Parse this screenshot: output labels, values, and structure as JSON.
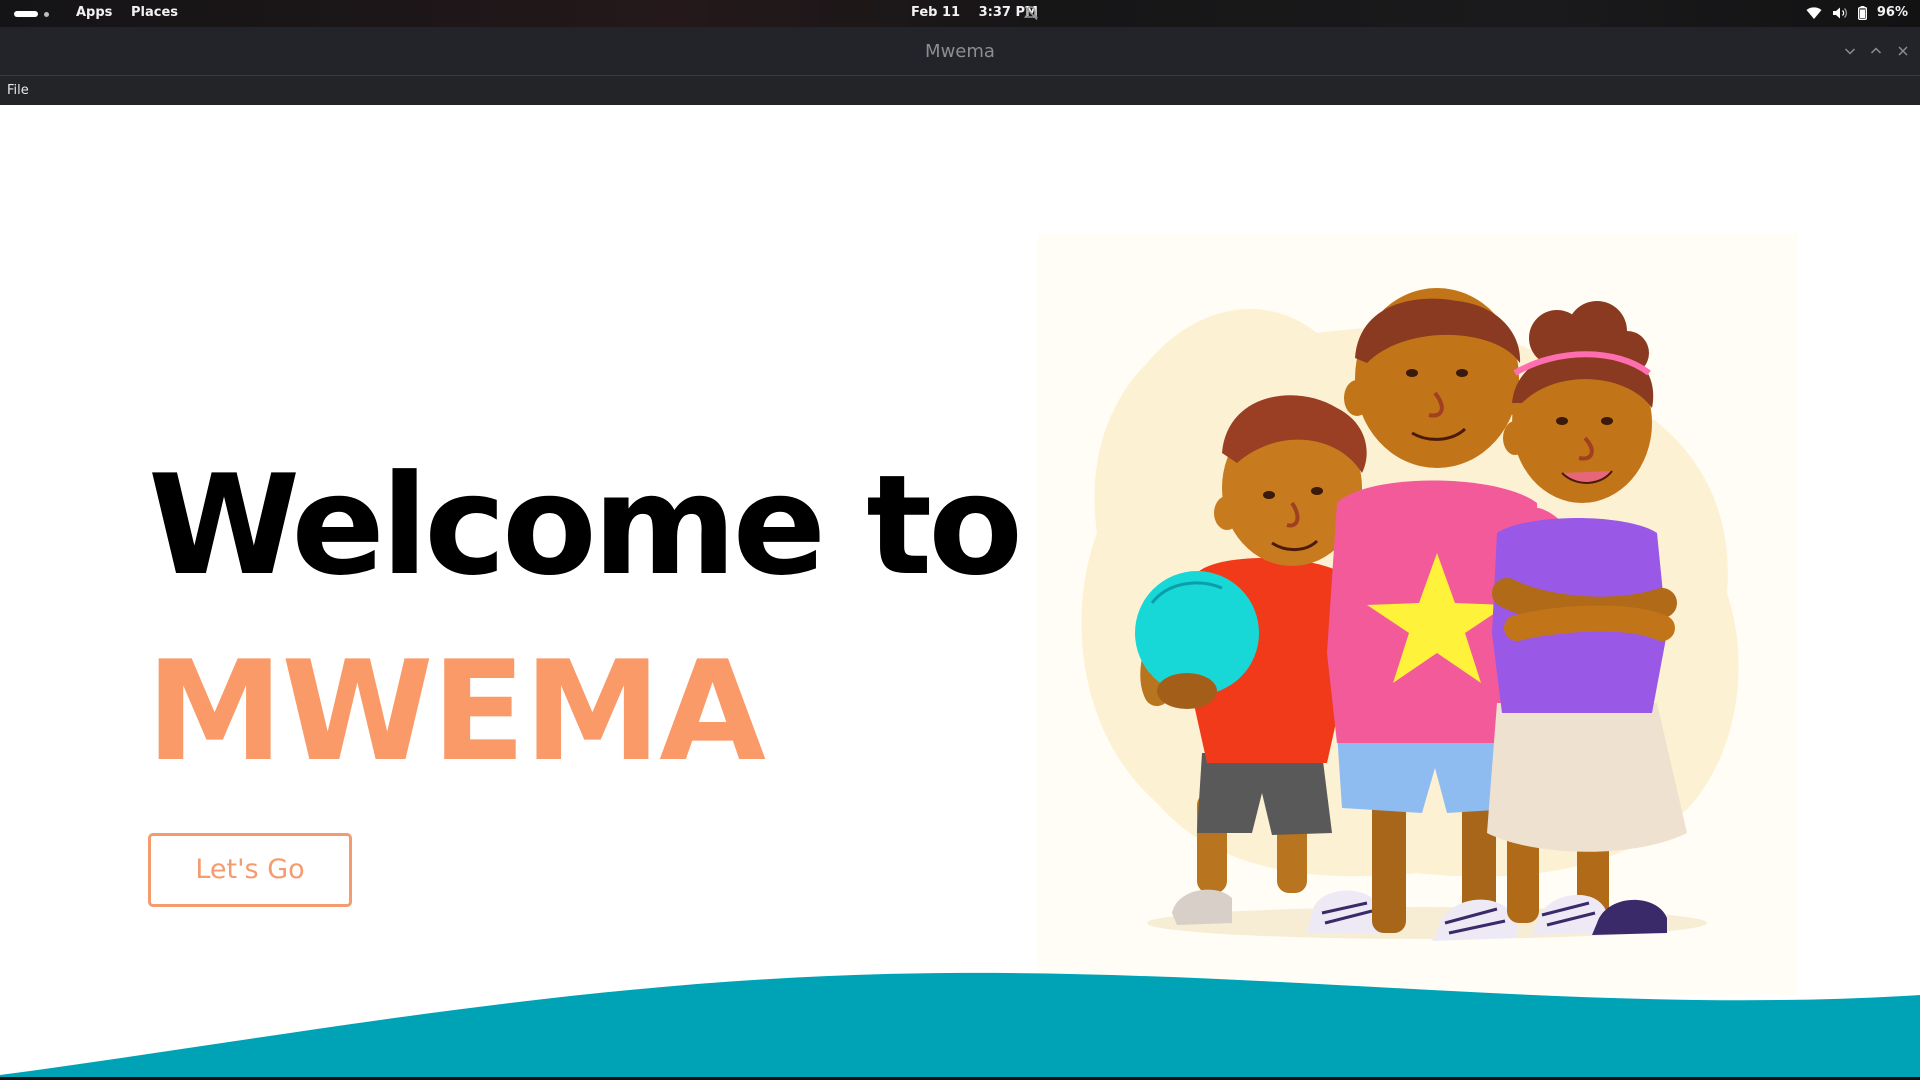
{
  "topbar": {
    "apps_label": "Apps",
    "places_label": "Places",
    "date": "Feb 11",
    "time": "3:37 PM",
    "battery_percent": "96%"
  },
  "window": {
    "title": "Mwema"
  },
  "menubar": {
    "file_label": "File"
  },
  "hero": {
    "headline": "Welcome to",
    "brand": "MWEMA",
    "cta_label": "Let's Go"
  },
  "colors": {
    "accent_orange": "#fa9a69",
    "wave_teal": "#00a3b5",
    "headline": "#000000"
  },
  "icons": [
    "notifications-muted-icon",
    "wifi-icon",
    "volume-icon",
    "battery-icon",
    "minimize-icon",
    "maximize-icon",
    "close-icon"
  ]
}
